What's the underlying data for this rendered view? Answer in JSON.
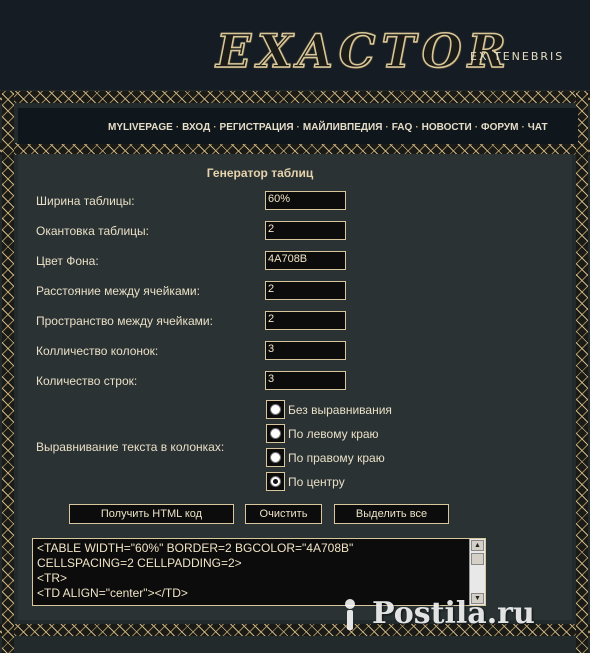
{
  "header": {
    "logo": "EXACTOR",
    "tagline": "EX TENEBRIS"
  },
  "nav": {
    "items": [
      "MYLIVEPAGE",
      "ВХОД",
      "РЕГИСТРАЦИЯ",
      "МАЙЛИВПЕДИЯ",
      "FAQ",
      "НОВОСТИ",
      "ФОРУМ",
      "ЧАТ"
    ],
    "separator": "·"
  },
  "generator": {
    "title": "Генератор таблиц",
    "fields": [
      {
        "label": "Ширина таблицы:",
        "value": "60%"
      },
      {
        "label": "Окантовка таблицы:",
        "value": "2"
      },
      {
        "label": "Цвет Фона:",
        "value": "4A708B"
      },
      {
        "label": "Расстояние между ячейками:",
        "value": "2"
      },
      {
        "label": "Пространство между ячейками:",
        "value": "2"
      },
      {
        "label": "Колличество колонок:",
        "value": "3"
      },
      {
        "label": "Количество строк:",
        "value": "3"
      }
    ],
    "alignment": {
      "label": "Выравнивание текста в колонках:",
      "options": [
        "Без выравнивания",
        "По левому краю",
        "По правому краю",
        "По центру"
      ],
      "selected": "По центру"
    },
    "buttons": {
      "get_code": "Получить HTML код",
      "clear": "Очистить",
      "select_all": "Выделить все"
    },
    "output": [
      "<TABLE WIDTH=\"60%\" BORDER=2 BGCOLOR=\"4A708B\"",
      "CELLSPACING=2 CELLPADDING=2>",
      "<TR>",
      "<TD ALIGN=\"center\"></TD>"
    ]
  },
  "watermark": "Postila.ru",
  "colors": {
    "background": "#232a2c",
    "accent": "#d8c79c",
    "field_bg": "#0c0c0c"
  }
}
